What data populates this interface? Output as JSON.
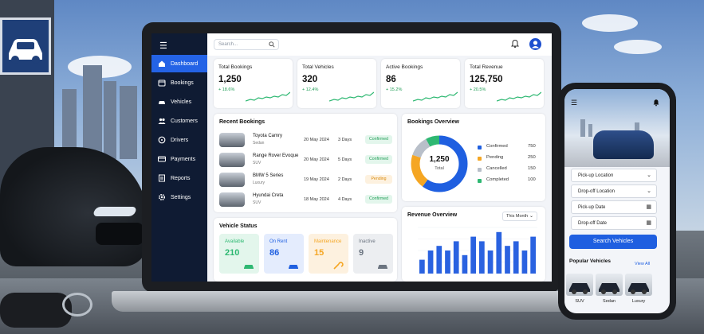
{
  "sidebar": {
    "items": [
      {
        "label": "Dashboard",
        "icon": "home-icon",
        "active": true
      },
      {
        "label": "Bookings",
        "icon": "calendar-icon"
      },
      {
        "label": "Vehicles",
        "icon": "car-icon"
      },
      {
        "label": "Customers",
        "icon": "users-icon"
      },
      {
        "label": "Drivers",
        "icon": "steering-wheel-icon"
      },
      {
        "label": "Payments",
        "icon": "card-icon"
      },
      {
        "label": "Reports",
        "icon": "report-icon"
      },
      {
        "label": "Settings",
        "icon": "gear-icon"
      }
    ]
  },
  "topbar": {
    "search_placeholder": "Search..."
  },
  "stats": [
    {
      "label": "Total Bookings",
      "value": "1,250",
      "change": "+ 18.6%"
    },
    {
      "label": "Total Vehicles",
      "value": "320",
      "change": "+ 12.4%"
    },
    {
      "label": "Active Bookings",
      "value": "86",
      "change": "+ 15.2%"
    },
    {
      "label": "Total Revenue",
      "value": "125,750",
      "change": "+ 20.5%"
    }
  ],
  "recent_bookings": {
    "title": "Recent Bookings",
    "rows": [
      {
        "name": "Toyota Camry",
        "type": "Sedan",
        "date": "20 May 2024",
        "days": "3 Days",
        "status": "Confirmed"
      },
      {
        "name": "Range Rover Evoque",
        "type": "SUV",
        "date": "20 May 2024",
        "days": "5 Days",
        "status": "Confirmed"
      },
      {
        "name": "BMW 5 Series",
        "type": "Luxury",
        "date": "19 May 2024",
        "days": "2 Days",
        "status": "Pending"
      },
      {
        "name": "Hyundai Creta",
        "type": "SUV",
        "date": "18 May 2024",
        "days": "4 Days",
        "status": "Confirmed"
      }
    ]
  },
  "bookings_overview": {
    "title": "Bookings Overview",
    "center_value": "1,250",
    "center_label": "Total",
    "legend": [
      {
        "label": "Confirmed",
        "value": "750",
        "color": "#1f5fe0"
      },
      {
        "label": "Pending",
        "value": "250",
        "color": "#f5a623"
      },
      {
        "label": "Cancelled",
        "value": "150",
        "color": "#b8bfc9"
      },
      {
        "label": "Completed",
        "value": "100",
        "color": "#2eb872"
      }
    ]
  },
  "vehicle_status": {
    "title": "Vehicle Status",
    "items": [
      {
        "label": "Available",
        "value": "210",
        "color": "#2eb872",
        "bg": "#e3f6ec"
      },
      {
        "label": "On Rent",
        "value": "86",
        "color": "#1f5fe0",
        "bg": "#e4ecfd"
      },
      {
        "label": "Maintenance",
        "value": "15",
        "color": "#f5a623",
        "bg": "#fdf1df"
      },
      {
        "label": "Inactive",
        "value": "9",
        "color": "#6b7480",
        "bg": "#eceef1"
      }
    ]
  },
  "revenue_overview": {
    "title": "Revenue Overview",
    "period": "This Month"
  },
  "chart_data": {
    "type": "bar",
    "values": [
      3,
      5,
      6,
      5,
      7,
      4,
      8,
      7,
      5,
      9,
      6,
      7,
      5,
      8
    ],
    "ylim": [
      0,
      10
    ]
  },
  "phone": {
    "fields": [
      {
        "label": "Pick-up Location",
        "icon": "chevron-down-icon"
      },
      {
        "label": "Drop-off Location",
        "icon": "chevron-down-icon"
      },
      {
        "label": "Pick-up Date",
        "icon": "calendar-icon"
      },
      {
        "label": "Drop-off Date",
        "icon": "calendar-icon"
      }
    ],
    "search_button": "Search Vehicles",
    "popular_title": "Popular Vehicles",
    "view_all": "View All",
    "popular": [
      "SUV",
      "Sedan",
      "Luxury"
    ]
  }
}
